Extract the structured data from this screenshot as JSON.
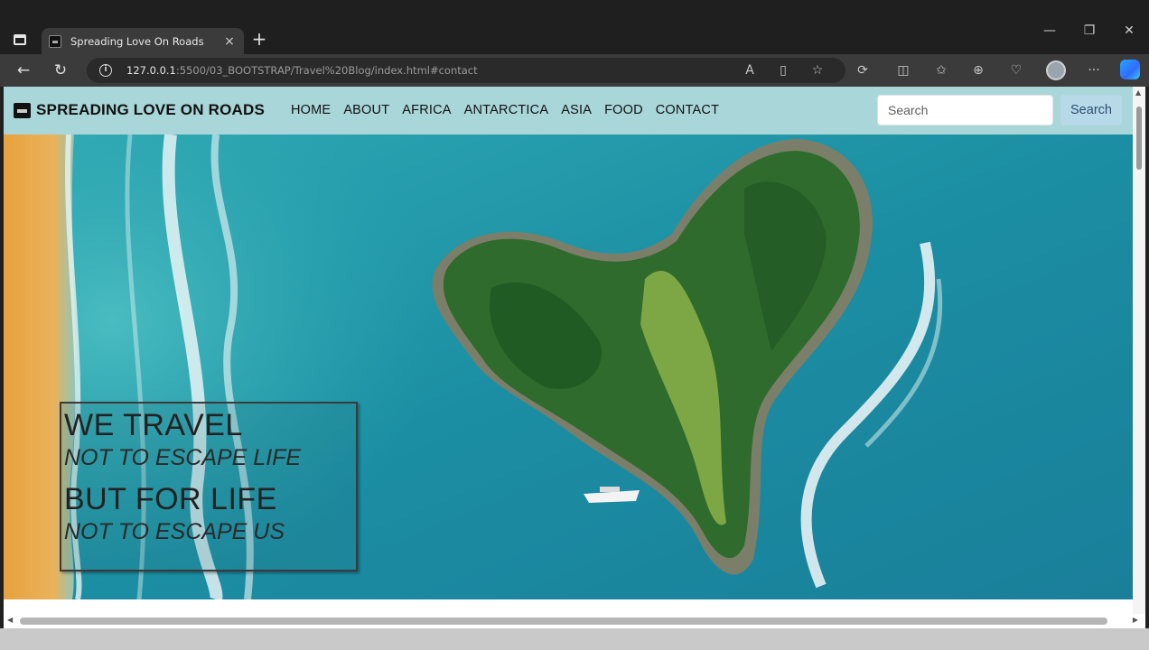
{
  "browser": {
    "tab_title": "Spreading Love On Roads",
    "tab_close": "×",
    "new_tab": "+",
    "url_host": "127.0.0.1",
    "url_rest": ":5500/03_BOOTSTRAP/Travel%20Blog/index.html#contact",
    "window": {
      "minimize": "—",
      "maximize": "❐",
      "close": "✕"
    },
    "icons": {
      "back": "arrow-left-icon",
      "refresh": "refresh-icon",
      "info": "info-icon",
      "read_aloud": "read-aloud-icon",
      "immersive_reader": "immersive-reader-icon",
      "favorite": "star-icon",
      "extensions": "puzzle-icon",
      "split_screen": "split-screen-icon",
      "favorites": "favorites-icon",
      "collections": "collections-icon",
      "browser_essentials": "heart-icon",
      "profile": "profile-avatar",
      "more": "more-icon",
      "copilot": "copilot-icon"
    }
  },
  "site": {
    "brand": "SPREADING LOVE ON ROADS",
    "nav": [
      "HOME",
      "ABOUT",
      "AFRICA",
      "ANTARCTICA",
      "ASIA",
      "FOOD",
      "CONTACT"
    ],
    "search_placeholder": "Search",
    "search_button": "Search",
    "colors": {
      "navbar": "#a9d6d8",
      "search_button_bg": "#b8d9e8",
      "search_button_text": "#2b4e72"
    }
  },
  "hero": {
    "line1": "WE TRAVEL",
    "line2": "NOT TO ESCAPE LIFE",
    "line3": "BUT FOR LIFE",
    "line4": "NOT TO ESCAPE US"
  }
}
